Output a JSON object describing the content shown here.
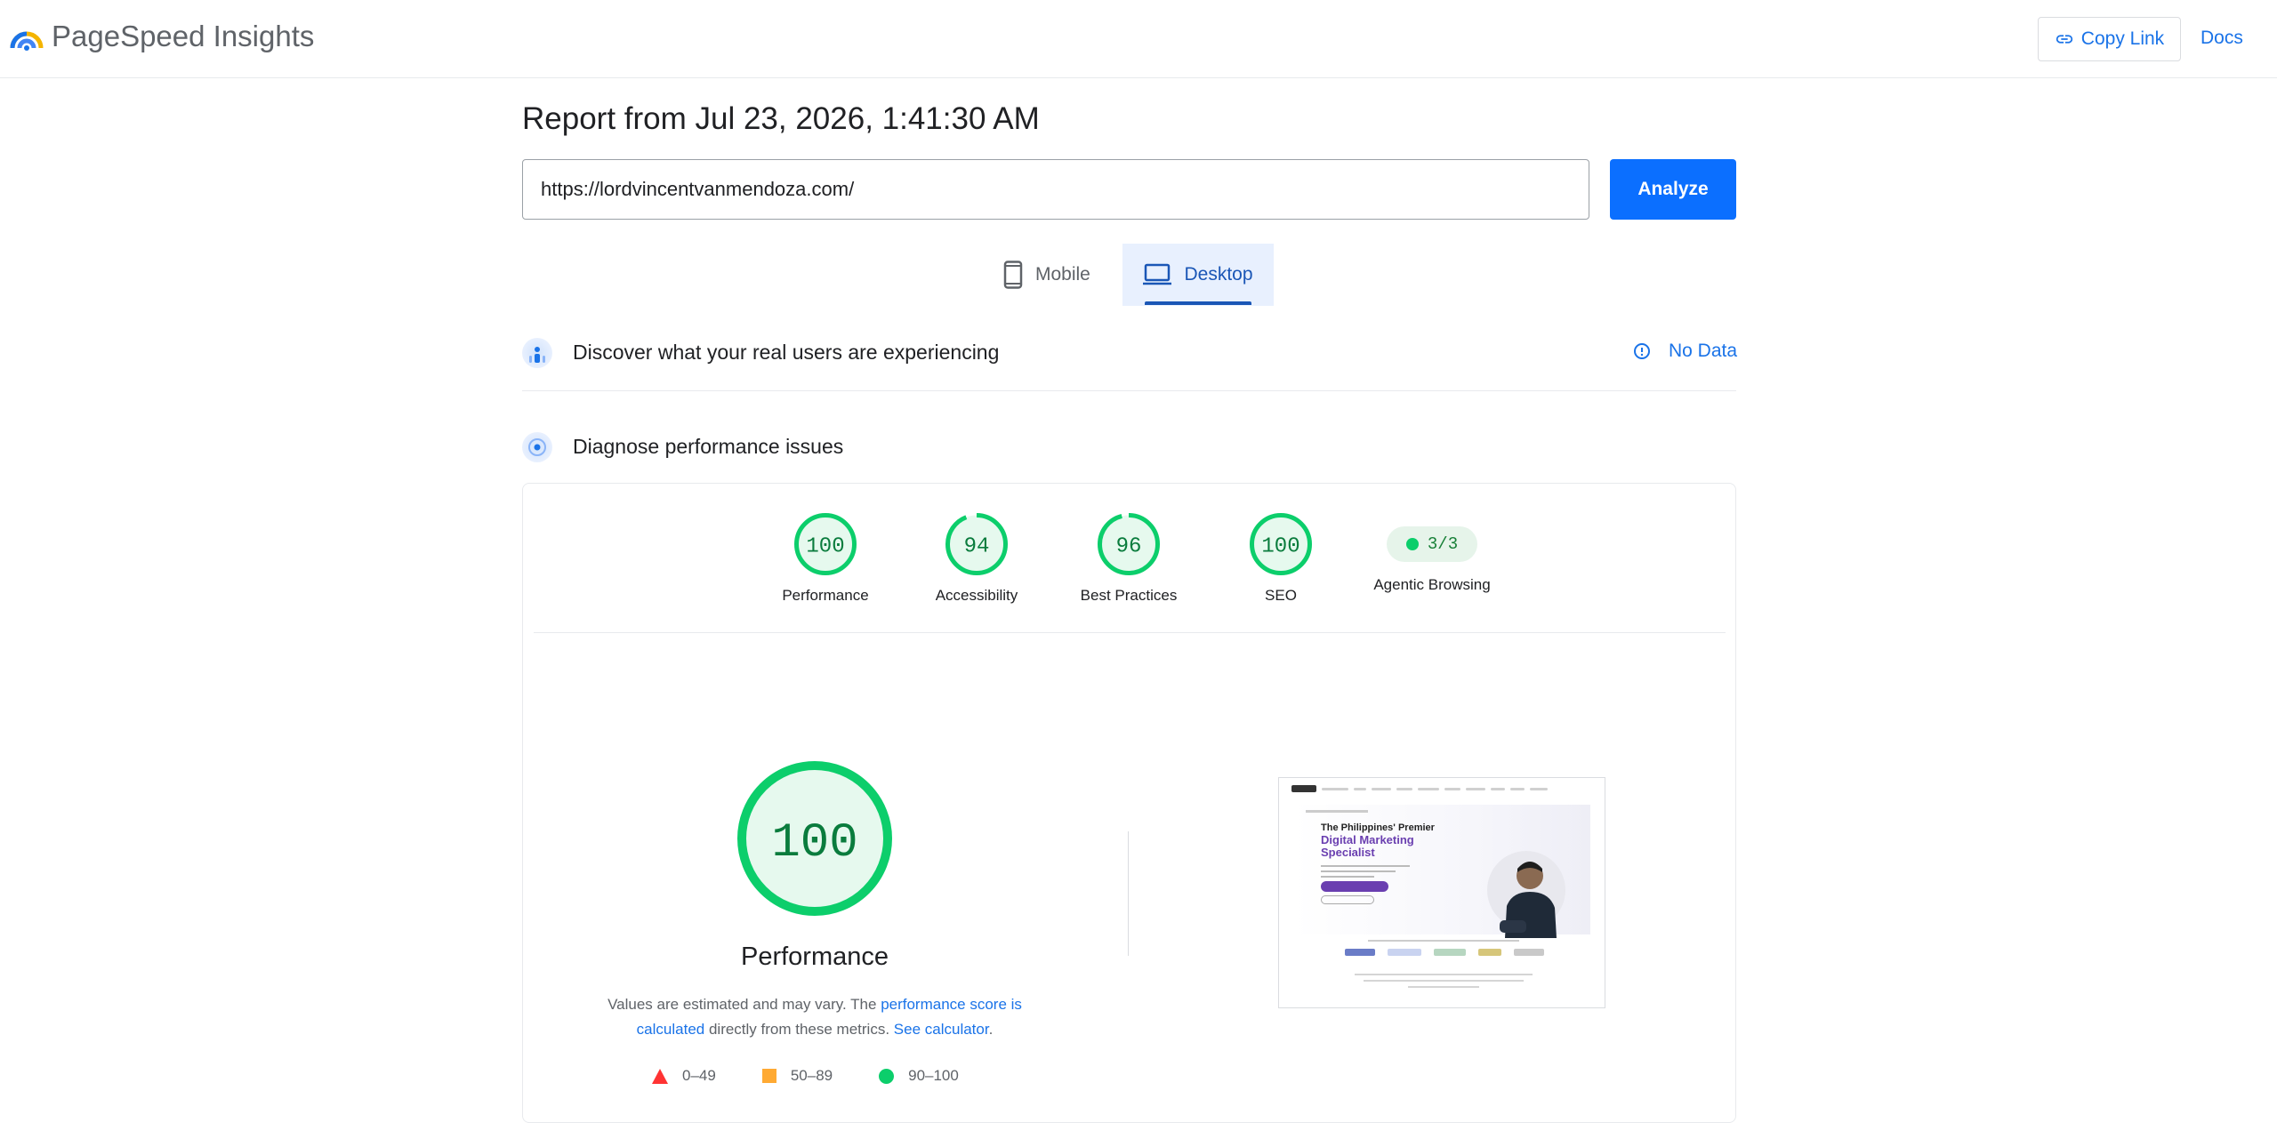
{
  "header": {
    "app_title": "PageSpeed Insights",
    "copy_link_label": "Copy Link",
    "docs_label": "Docs"
  },
  "report": {
    "title": "Report from Jul 23, 2026, 1:41:30 AM",
    "url_value": "https://lordvincentvanmendoza.com/",
    "analyze_label": "Analyze"
  },
  "tabs": [
    {
      "label": "Mobile",
      "icon": "smartphone-icon",
      "selected": false
    },
    {
      "label": "Desktop",
      "icon": "laptop-icon",
      "selected": true
    }
  ],
  "sections": {
    "field_title": "Discover what your real users are experiencing",
    "no_data_label": "No Data",
    "lab_title": "Diagnose performance issues"
  },
  "scores": [
    {
      "value": 100,
      "label": "Performance"
    },
    {
      "value": 94,
      "label": "Accessibility"
    },
    {
      "value": 96,
      "label": "Best Practices"
    },
    {
      "value": 100,
      "label": "SEO"
    }
  ],
  "agentic": {
    "value": "3/3",
    "label": "Agentic Browsing"
  },
  "performance": {
    "score": 100,
    "title": "Performance",
    "desc_prefix": "Values are estimated and may vary. The ",
    "desc_link1": "performance score is calculated",
    "desc_middle": " directly from these metrics. ",
    "desc_link2": "See calculator",
    "desc_suffix": "."
  },
  "legend": [
    {
      "range": "0–49",
      "shape": "triangle",
      "color": "#ff3333"
    },
    {
      "range": "50–89",
      "shape": "square",
      "color": "#ffaa33"
    },
    {
      "range": "90–100",
      "shape": "circle",
      "color": "#0cce6b"
    }
  ],
  "thumbnail": {
    "headline": "The Philippines' Premier",
    "subheadline_line1": "Digital Marketing",
    "subheadline_line2": "Specialist"
  },
  "colors": {
    "good": "#0cce6b",
    "good_text": "#0a7c3d",
    "good_fill": "#e6f9ee",
    "accent": "#1a73e8",
    "analyze_bg": "#0b6fff"
  }
}
